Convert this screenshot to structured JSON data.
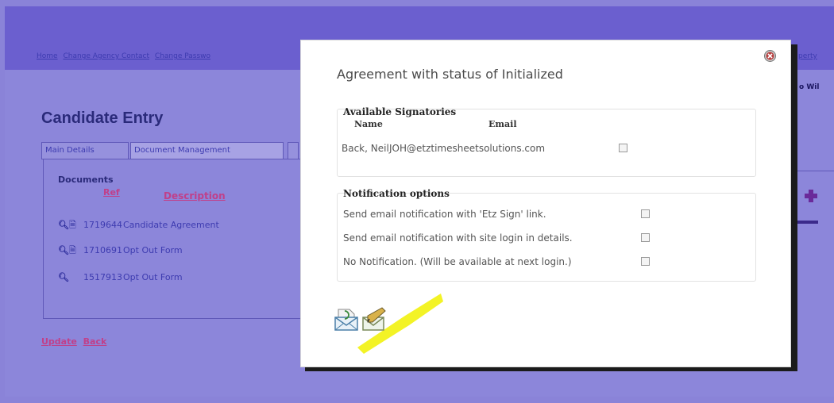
{
  "background": {
    "topnav": [
      "Home",
      "Change Agency Contact",
      "Change Passwo"
    ],
    "topnav_right": "perty",
    "user_right": "o Wil",
    "page_title": "Candidate Entry",
    "tabs": [
      {
        "label": "Main Details"
      },
      {
        "label": "Document Management"
      }
    ],
    "documents_label": "Documents",
    "columns": {
      "ref": "Ref",
      "description": "Description"
    },
    "documents": [
      {
        "ref": "1719644",
        "description": "Candidate Agreement"
      },
      {
        "ref": "1710691",
        "description": "Opt Out Form"
      },
      {
        "ref": "1517913",
        "description": "Opt Out Form"
      }
    ],
    "actions": {
      "update": "Update",
      "back": "Back"
    }
  },
  "modal": {
    "title": "Agreement with status of Initialized",
    "signatories": {
      "legend": "Available Signatories",
      "col_name": "Name",
      "col_email": "Email",
      "rows": [
        {
          "name": "Back, Neil",
          "email": "JOH@etztimesheetsolutions.com",
          "checked": false
        }
      ]
    },
    "notifications": {
      "legend": "Notification options",
      "options": [
        {
          "label": "Send email notification with 'Etz Sign' link.",
          "checked": false
        },
        {
          "label": "Send email notification with site login in details.",
          "checked": false
        },
        {
          "label": "No Notification. (Will be available at next login.)",
          "checked": false
        }
      ]
    },
    "icons": {
      "close": "close-icon",
      "email": "email-icon",
      "sign": "sign-document-icon"
    }
  },
  "colors": {
    "overlay_bg": "#8a83d8",
    "header_bg": "#6b5fcf",
    "highlight": "#f2f21a",
    "modal_bg": "#ffffff"
  }
}
